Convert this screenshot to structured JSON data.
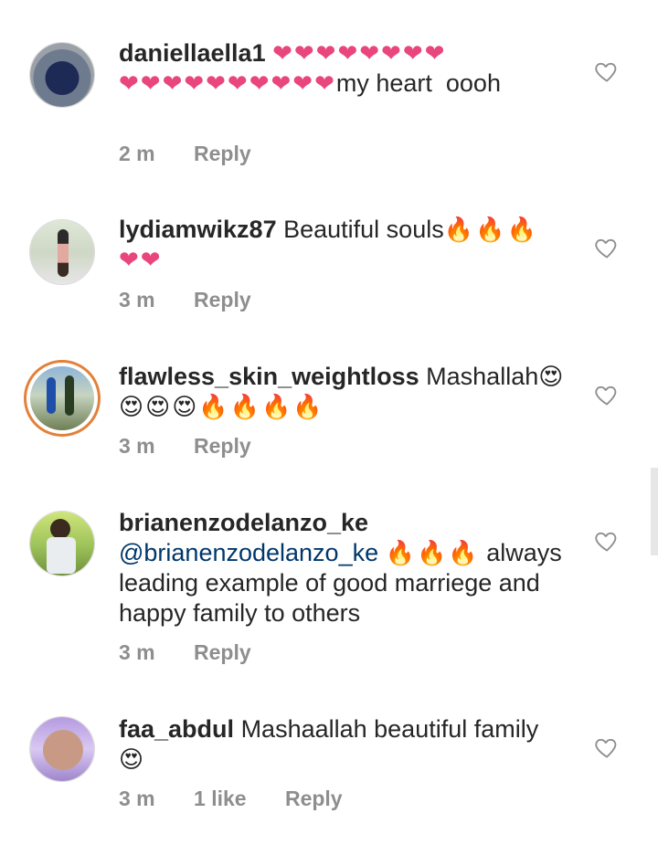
{
  "comments": [
    {
      "username": "daniellaella1",
      "emoji_line1": "❤❤❤❤❤❤❤❤",
      "emoji_line2": "❤❤❤❤❤❤❤❤❤❤",
      "text": "my heart  oooh",
      "time": "2 m",
      "reply": "Reply"
    },
    {
      "username": "lydiamwikz87",
      "text": "Beautiful souls",
      "emoji_fire": "🔥🔥🔥",
      "emoji_line2": "❤❤",
      "time": "3 m",
      "reply": "Reply"
    },
    {
      "username": "flawless_skin_weightloss",
      "text": "Mashallah",
      "emoji_a": "😍",
      "emoji_line2": "😍😍😍🔥🔥🔥🔥",
      "time": "3 m",
      "reply": "Reply"
    },
    {
      "username": "brianenzodelanzo_ke",
      "mention": "@brianenzodelanzo_ke",
      "emoji_fire": "🔥🔥🔥",
      "text": "always leading example of good marriege and happy family to others",
      "time": "3 m",
      "reply": "Reply"
    },
    {
      "username": "faa_abdul",
      "text": "Mashaallah beautiful family",
      "emoji_line2": "😍",
      "time": "3 m",
      "likes": "1 like",
      "reply": "Reply"
    }
  ],
  "icons": {
    "like": "heart-outline-icon"
  },
  "colors": {
    "text": "#262626",
    "meta": "#8e8e8e",
    "mention": "#00376b",
    "ring": "#e2813a"
  }
}
